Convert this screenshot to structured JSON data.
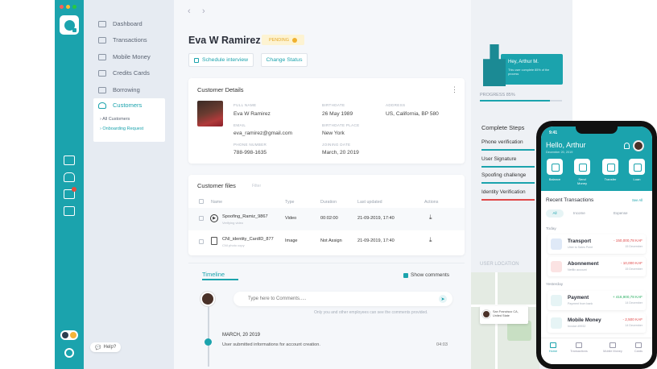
{
  "nav": {
    "items": [
      {
        "label": "Dashboard"
      },
      {
        "label": "Transactions"
      },
      {
        "label": "Mobile Money"
      },
      {
        "label": "Credits Cards"
      },
      {
        "label": "Borrowing"
      },
      {
        "label": "Customers"
      }
    ],
    "sub_items": [
      "All Customers",
      "Onboarding Request"
    ],
    "help_label": "Help?"
  },
  "header": {
    "customer_name": "Eva W Ramirez",
    "status_badge": "PENDING",
    "schedule_button": "Schedule interview",
    "change_status_button": "Change Status"
  },
  "customer_details": {
    "title": "Customer Details",
    "fields": [
      {
        "label": "FULL NAME",
        "value": "Eva W Ramirez"
      },
      {
        "label": "BIRTHDATE",
        "value": "26 May 1989"
      },
      {
        "label": "ADDRESS",
        "value": "US, California, BP 580"
      },
      {
        "label": "EMAIL",
        "value": "eva_ramirez@gmail.com"
      },
      {
        "label": "BIRTHDATE PLACE",
        "value": "New York"
      },
      {
        "label": "PHONE NUMBER",
        "value": "788-998-1635"
      },
      {
        "label": "JOINING DATE",
        "value": "March, 20 2019"
      }
    ]
  },
  "customer_files": {
    "title": "Customer files",
    "filter_label": "Filter",
    "columns": [
      "Name",
      "Type",
      "Duration",
      "Last updated",
      "Actions"
    ],
    "rows": [
      {
        "name": "Spoofing_Ramiz_9867",
        "sub": "Verifying video",
        "type": "Video",
        "duration": "00:02:00",
        "updated": "21-09-2019, 17:40"
      },
      {
        "name": "CNI_identity_CardID_877",
        "sub": "CNI photo copy",
        "type": "Image",
        "duration": "Not Assign",
        "updated": "21-09-2019, 17:40"
      }
    ]
  },
  "timeline": {
    "title": "Timeline",
    "show_comments": "Show comments",
    "comment_placeholder": "Type here to Comments.....",
    "comment_note": "Only you and other employees can see the comments provided.",
    "event_date": "MARCH, 20 2019",
    "event_text": "User submitted informations for account creation.",
    "event_time": "04:03"
  },
  "side_panel": {
    "greeting": "Hey, Arthur M.",
    "greeting_sub": "This user complete 85% of the process",
    "progress_label": "PROGRESS 85%",
    "progress": 0.85,
    "steps_title": "Complete Steps",
    "steps": [
      {
        "label": "Phone verification",
        "color": "#1ba3ad"
      },
      {
        "label": "User Signature",
        "color": "#1ba3ad"
      },
      {
        "label": "Spoofing challenge",
        "color": "#1ba3ad"
      },
      {
        "label": "Identity Verification",
        "color": "#e04848"
      }
    ],
    "location_label": "USER LOCATION",
    "location_pin": "San Francisco CA, United State"
  },
  "phone": {
    "time": "9:41",
    "greeting": "Hello, Arthur",
    "date": "December 20, 2019",
    "actions": [
      "Balance",
      "Send Money",
      "Transfer",
      "Loan"
    ],
    "recent_title": "Recent Transactions",
    "see_all": "See All",
    "filters": [
      "All",
      "Income",
      "Expense"
    ],
    "sections": [
      "Today",
      "Yesterday"
    ],
    "transactions": [
      {
        "name": "Transport",
        "desc": "Uber to Sales Point",
        "amount": "- 150,000,78 KAF",
        "date": "15 December",
        "amount_color": "#e04848",
        "icon_color": "#dfe9f7"
      },
      {
        "name": "Abonnement",
        "desc": "Netflix account",
        "amount": "- 10,000 KAF",
        "date": "15 December",
        "amount_color": "#e04848",
        "icon_color": "#fbe3e3"
      },
      {
        "name": "Payment",
        "desc": "Payment from bank",
        "amount": "+ 416,900,78 KAF",
        "date": "14 December",
        "amount_color": "#27ae60",
        "icon_color": "#e6f4f5"
      },
      {
        "name": "Mobile Money",
        "desc": "Invoice #9932",
        "amount": "- 2,500 KAF",
        "date": "14 December",
        "amount_color": "#e04848",
        "icon_color": "#e6f4f5"
      }
    ],
    "tabs": [
      "Home",
      "Transactions",
      "Mobile Money",
      "Cards"
    ]
  }
}
